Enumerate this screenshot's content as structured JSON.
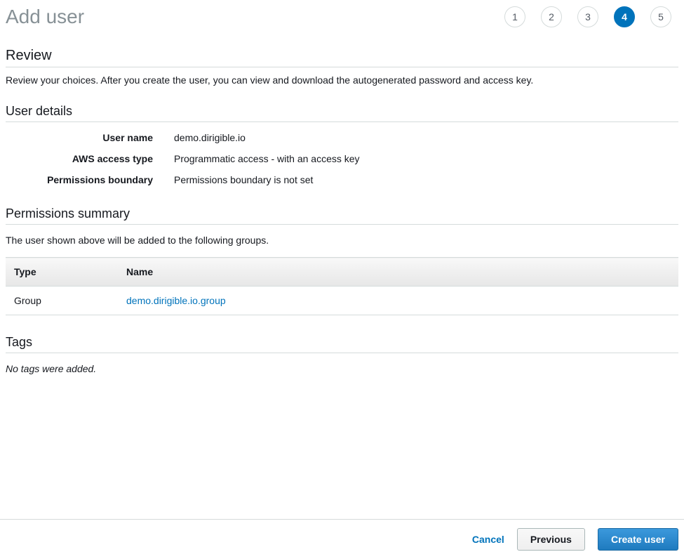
{
  "header": {
    "title": "Add user"
  },
  "stepper": {
    "steps": [
      "1",
      "2",
      "3",
      "4",
      "5"
    ],
    "active_index": 3
  },
  "review": {
    "title": "Review",
    "description": "Review your choices. After you create the user, you can view and download the autogenerated password and access key."
  },
  "user_details": {
    "title": "User details",
    "rows": [
      {
        "label": "User name",
        "value": "demo.dirigible.io"
      },
      {
        "label": "AWS access type",
        "value": "Programmatic access - with an access key"
      },
      {
        "label": "Permissions boundary",
        "value": "Permissions boundary is not set"
      }
    ]
  },
  "permissions_summary": {
    "title": "Permissions summary",
    "description": "The user shown above will be added to the following groups.",
    "columns": [
      "Type",
      "Name"
    ],
    "rows": [
      {
        "type": "Group",
        "name": "demo.dirigible.io.group"
      }
    ]
  },
  "tags": {
    "title": "Tags",
    "empty_text": "No tags were added."
  },
  "footer": {
    "cancel": "Cancel",
    "previous": "Previous",
    "create_user": "Create user"
  }
}
